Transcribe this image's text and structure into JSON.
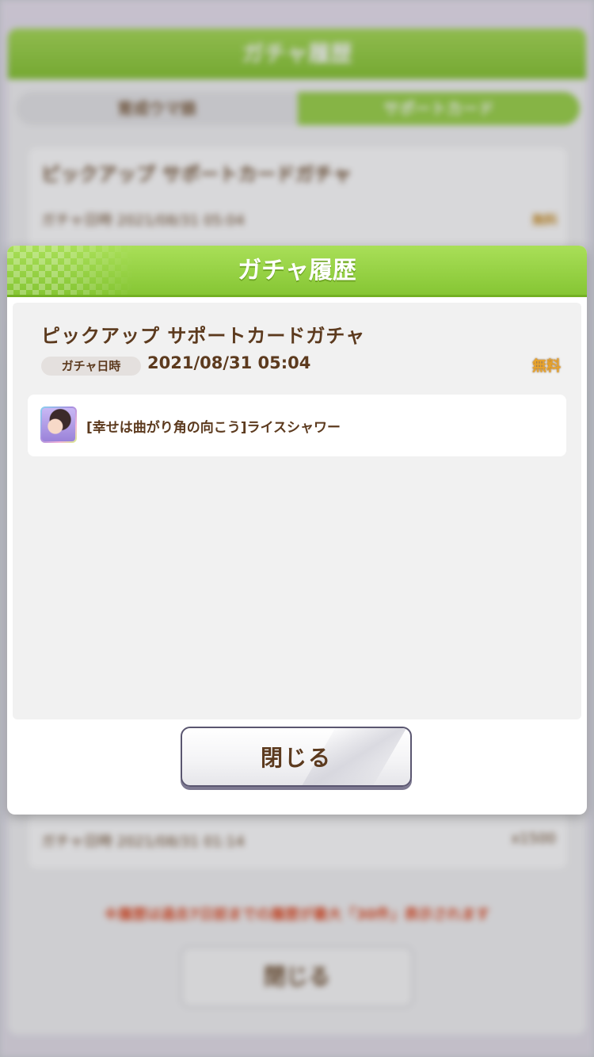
{
  "background": {
    "title": "ガチャ履歴",
    "tabs": [
      "育成ウマ娘",
      "サポートカード"
    ],
    "active_tab": "サポートカード",
    "entries": [
      {
        "name": "ピックアップ サポートカードガチャ",
        "date_label": "ガチャ日時",
        "date": "2021/08/31 05:04",
        "cost": "無料"
      },
      {
        "date_label": "ガチャ日時",
        "date": "2021/08/31 01:14",
        "cost": "x1500"
      }
    ],
    "notice": "※履歴は過去7日前までの履歴が最大「30件」表示されます",
    "close_label": "閉じる"
  },
  "dialog": {
    "title": "ガチャ履歴",
    "gacha_name": "ピックアップ サポートカードガチャ",
    "date_label": "ガチャ日時",
    "date": "2021/08/31 05:04",
    "cost_badge": "無料",
    "results": [
      {
        "card_name": "[幸せは曲がり角の向こう]ライスシャワー",
        "icon": "support-card-thumbnail"
      }
    ],
    "close_label": "閉じる"
  },
  "colors": {
    "header_green": "#86c634",
    "text_brown": "#5c3a1e",
    "free_gold": "#e8a32c"
  }
}
